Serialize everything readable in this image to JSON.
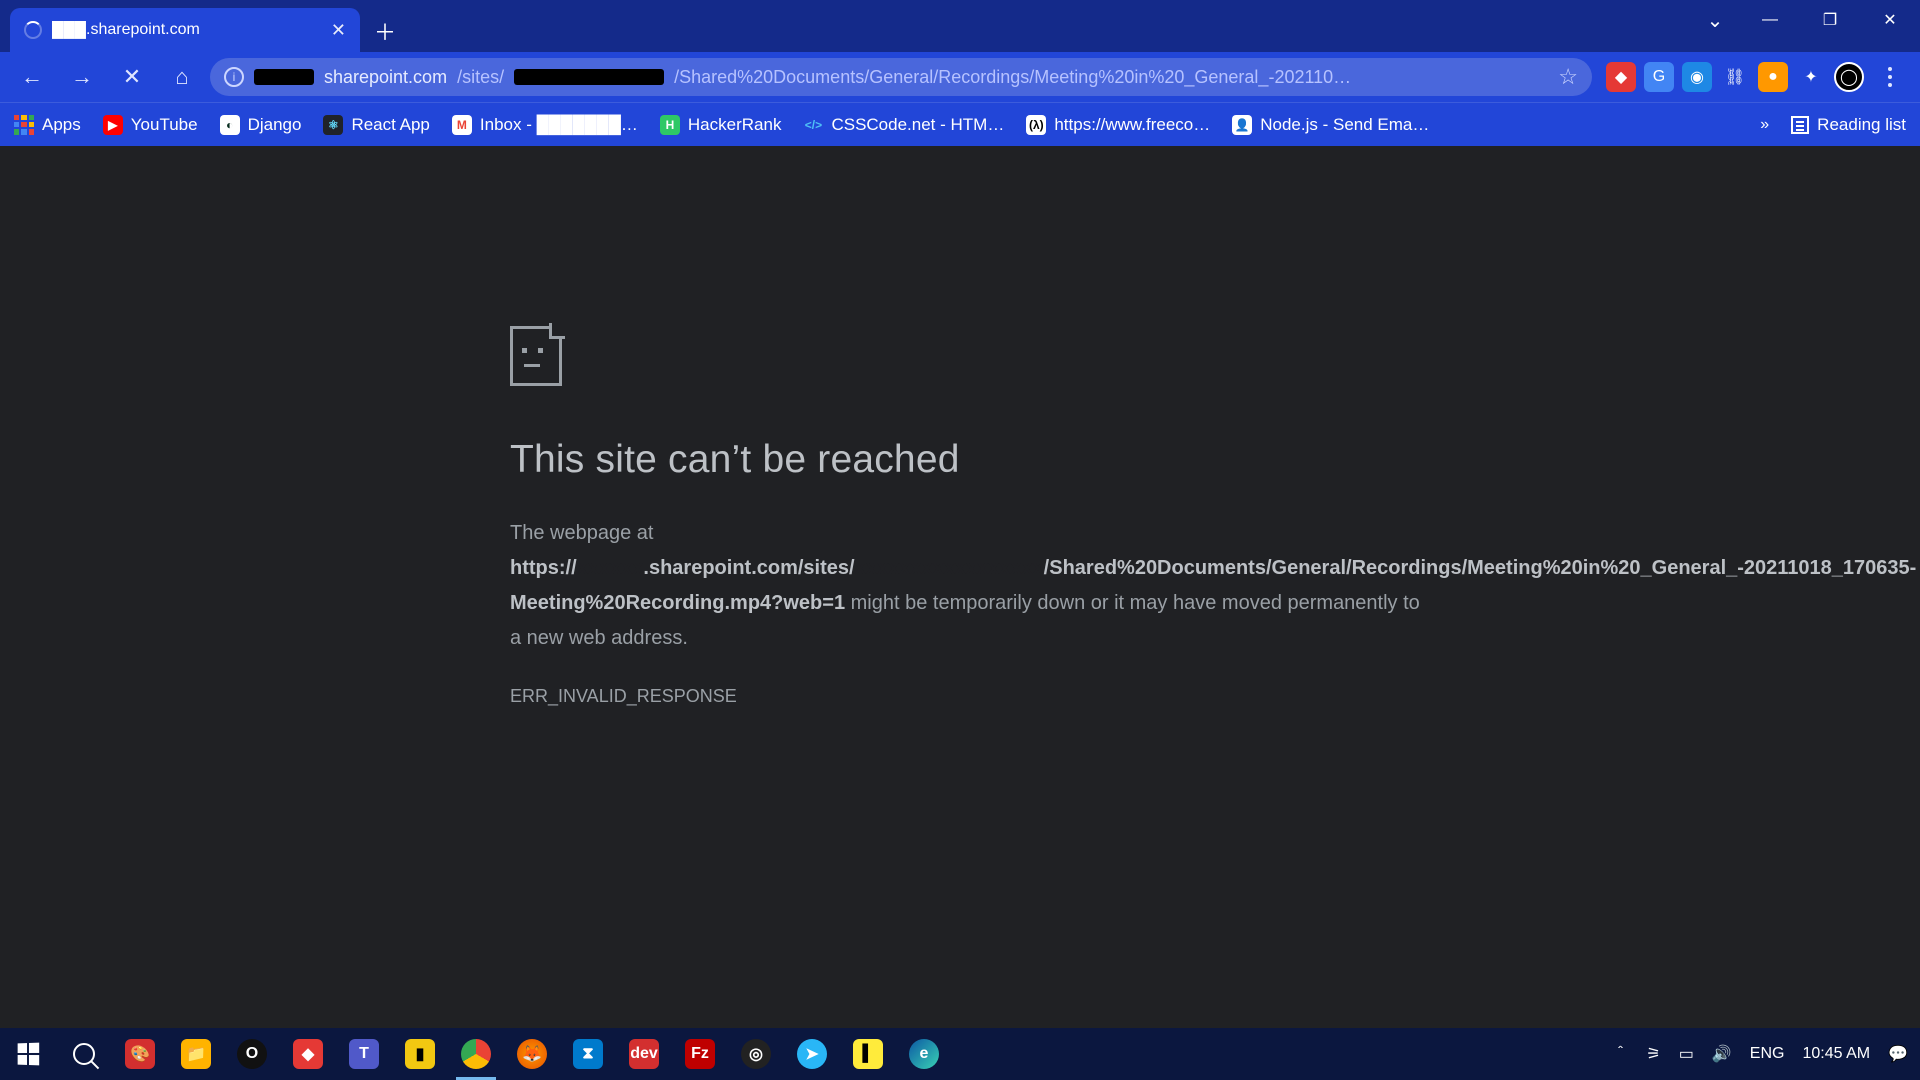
{
  "tab": {
    "title": "███.sharepoint.com"
  },
  "url": {
    "host_suffix": "sharepoint.com",
    "sites": "/sites/",
    "path_rest": "/Shared%20Documents/General/Recordings/Meeting%20in%20_General_-202110…"
  },
  "bookmarks": {
    "apps": "Apps",
    "items": [
      "YouTube",
      "Django",
      "React App",
      "Inbox - ███████…",
      "HackerRank",
      "CSSCode.net - HTM…",
      "https://www.freeco…",
      "Node.js - Send Ema…"
    ],
    "overflow": "»",
    "reading": "Reading list"
  },
  "error": {
    "heading": "This site can’t be reached",
    "p_prefix": "The webpage at ",
    "bold_pre": "https://",
    "bold_mid": ".sharepoint.com/sites/",
    "bold_path": "/Shared%20Documents/General/Recordings/Meeting%20in%20_General_-20211018_170635-Meeting%20Recording.mp4?web=1",
    "p_suffix": " might be temporarily down or it may have moved permanently to a new web address.",
    "code": "ERR_INVALID_RESPONSE"
  },
  "tray": {
    "lang": "ENG",
    "time": "10:45 AM"
  }
}
